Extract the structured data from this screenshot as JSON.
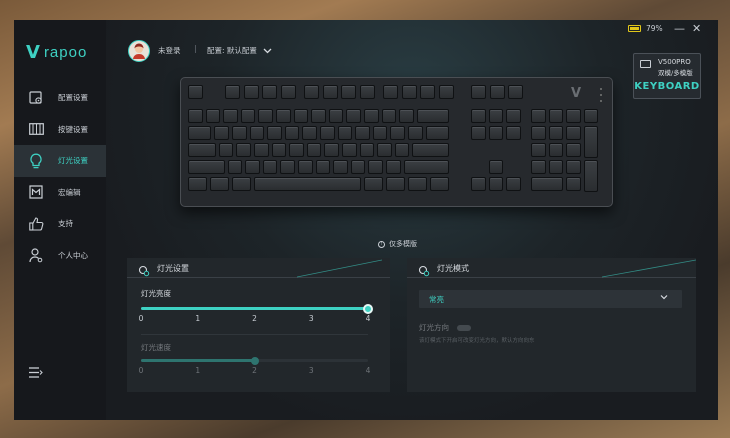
{
  "app": {
    "brand": "rapoo"
  },
  "sidebar": {
    "items": [
      {
        "label": "配置设置",
        "icon": "profile-config-icon",
        "active": false
      },
      {
        "label": "按键设置",
        "icon": "keys-settings-icon",
        "active": false
      },
      {
        "label": "灯光设置",
        "icon": "lightbulb-icon",
        "active": true
      },
      {
        "label": "宏编辑",
        "icon": "macro-editor-icon",
        "active": false
      },
      {
        "label": "支持",
        "icon": "thumbs-up-icon",
        "active": false
      },
      {
        "label": "个人中心",
        "icon": "user-center-icon",
        "active": false
      }
    ],
    "menu_icon": "menu-list-icon"
  },
  "header": {
    "user": "未登录",
    "separator": "|",
    "profile": "配置: 默认配置",
    "battery_percent": "79%",
    "battery_level": 0.79,
    "minimize_label": "—",
    "close_label": "✕"
  },
  "device": {
    "model": "V500PRO",
    "mode": "双模/多模版",
    "brand_label": "KEYBOARD"
  },
  "multimode_note": "仅多模版",
  "light_settings": {
    "title": "灯光设置",
    "brightness": {
      "label": "灯光亮度",
      "value": 4,
      "min": 0,
      "max": 4,
      "ticks": [
        "0",
        "1",
        "2",
        "3",
        "4"
      ]
    },
    "speed": {
      "label": "灯光速度",
      "value": 2,
      "min": 0,
      "max": 4,
      "ticks": [
        "0",
        "1",
        "2",
        "3",
        "4"
      ],
      "disabled": true
    }
  },
  "light_mode": {
    "title": "灯光模式",
    "selected": "常亮",
    "direction_label": "灯光方向",
    "direction_hint": "该灯模式下开启可改变灯光方向，默认方向向东"
  },
  "colors": {
    "accent": "#3ed1c3",
    "battery": "#e0c61a"
  }
}
